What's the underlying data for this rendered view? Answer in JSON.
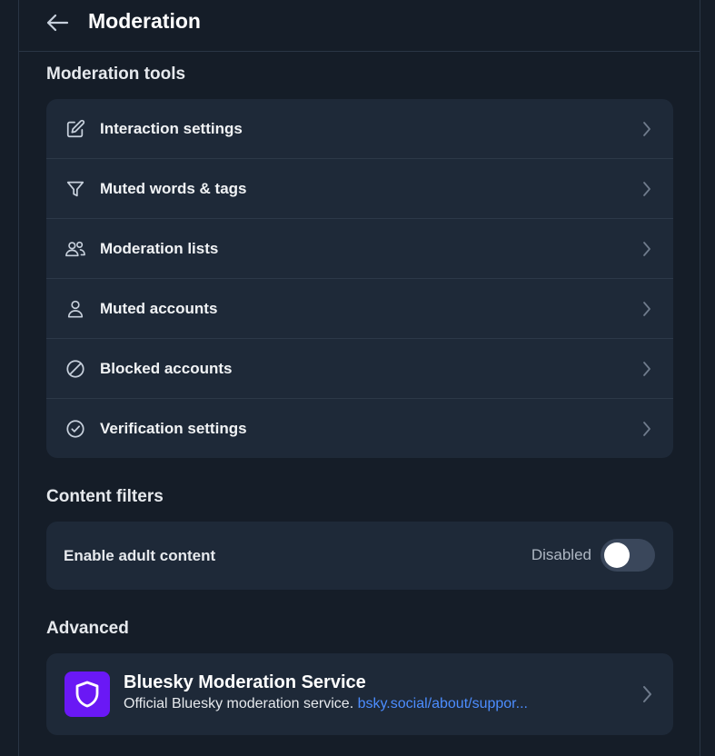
{
  "header": {
    "title": "Moderation",
    "back_icon": "arrow-left-icon"
  },
  "tools": {
    "title": "Moderation tools",
    "items": [
      {
        "label": "Interaction settings",
        "icon": "pencil-square-icon"
      },
      {
        "label": "Muted words & tags",
        "icon": "filter-icon"
      },
      {
        "label": "Moderation lists",
        "icon": "people-icon"
      },
      {
        "label": "Muted accounts",
        "icon": "person-icon"
      },
      {
        "label": "Blocked accounts",
        "icon": "block-icon"
      },
      {
        "label": "Verification settings",
        "icon": "circle-check-icon"
      }
    ]
  },
  "filters": {
    "title": "Content filters",
    "adult": {
      "label": "Enable adult content",
      "status": "Disabled",
      "enabled": false
    }
  },
  "advanced": {
    "title": "Advanced",
    "service": {
      "name": "Bluesky Moderation Service",
      "description": "Official Bluesky moderation service.",
      "link": "bsky.social/about/suppor..."
    }
  },
  "colors": {
    "accent": "#4c8dff",
    "avatar": "#6a18f5",
    "background": "#151d28",
    "card": "#1e2938"
  }
}
